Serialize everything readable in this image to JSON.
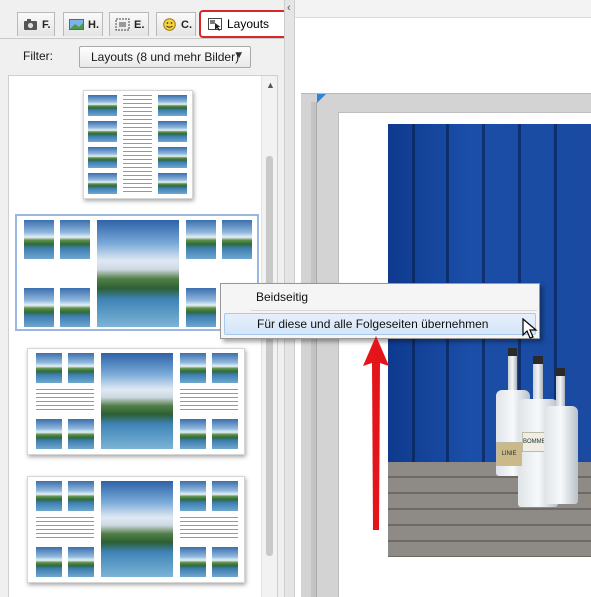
{
  "tabs": [
    {
      "label": "F."
    },
    {
      "label": "H."
    },
    {
      "label": "E."
    },
    {
      "label": "C."
    },
    {
      "label": "Layouts"
    }
  ],
  "filter": {
    "label": "Filter:",
    "selected": "Layouts (8 und mehr Bilder)"
  },
  "context_menu": {
    "items": [
      {
        "label": "Beidseitig"
      },
      {
        "label": "Für diese und alle Folgeseiten übernehmen"
      }
    ]
  },
  "photo_labels": {
    "bottle_1": "LINIE",
    "bottle_2": "BOMMERLU"
  },
  "colors": {
    "highlight_outline": "#d9262a",
    "arrow": "#e3151b",
    "menu_hover": "#d4e5f8",
    "selection_border": "#9ab7df"
  }
}
